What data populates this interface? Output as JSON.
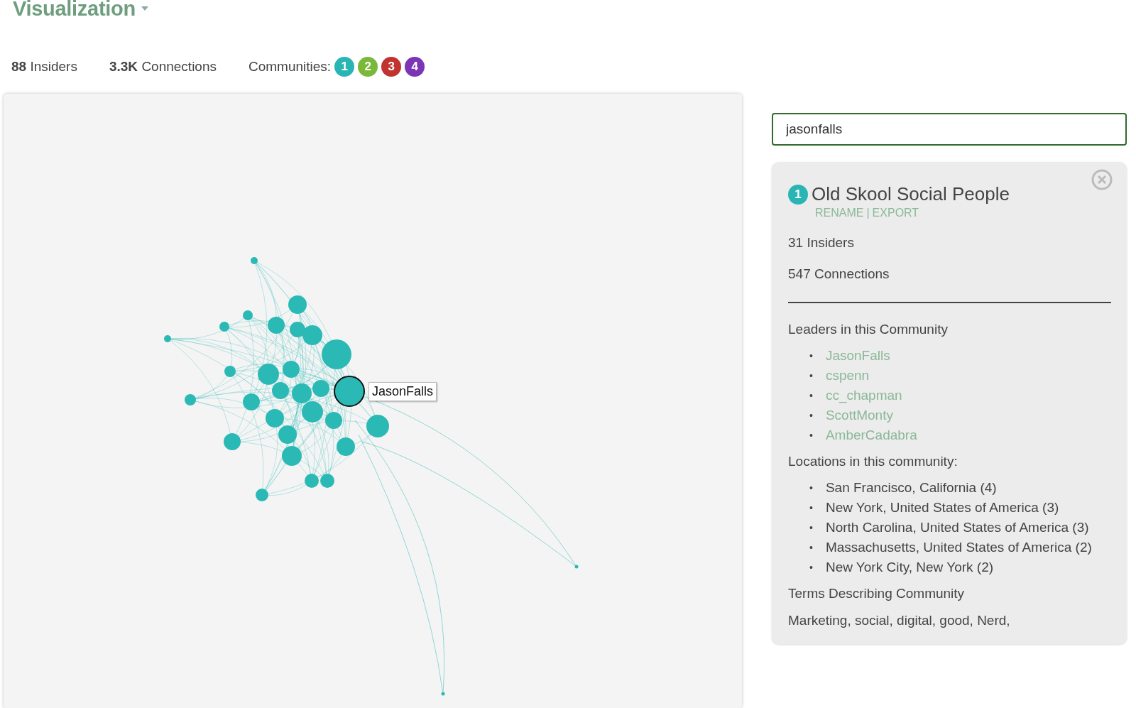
{
  "header": {
    "title": "Visualization"
  },
  "stats": [
    {
      "value": "88",
      "label": "Insiders"
    },
    {
      "value": "3.3K",
      "label": "Connections"
    }
  ],
  "communities": {
    "label": "Communities:",
    "items": [
      {
        "number": "1",
        "color": "#2ab5b5"
      },
      {
        "number": "2",
        "color": "#7ab83a"
      },
      {
        "number": "3",
        "color": "#c0332f"
      },
      {
        "number": "4",
        "color": "#7b35b5"
      }
    ]
  },
  "graph": {
    "node_label": "JasonFalls"
  },
  "search": {
    "value": "jasonfalls"
  },
  "community_card": {
    "number": "1",
    "color": "#2ab5b5",
    "title": "Old Skool Social People",
    "actions": [
      "RENAME",
      "EXPORT"
    ],
    "separator": "|",
    "insiders": "31 Insiders",
    "connections": "547 Connections",
    "bullet": "•",
    "leaders_heading": "Leaders in this Community",
    "leaders": [
      "JasonFalls",
      "cspenn",
      "cc_chapman",
      "ScottMonty",
      "AmberCadabra"
    ],
    "locations_heading": "Locations in this community:",
    "locations": [
      "San Francisco, California (4)",
      "New York, United States of America (3)",
      "North Carolina, United States of America (3)",
      "Massachusetts, United States of America (2)",
      "New York City, New York (2)"
    ],
    "terms_heading": "Terms Describing Community",
    "terms": "Marketing, social, digital, good, Nerd,"
  }
}
